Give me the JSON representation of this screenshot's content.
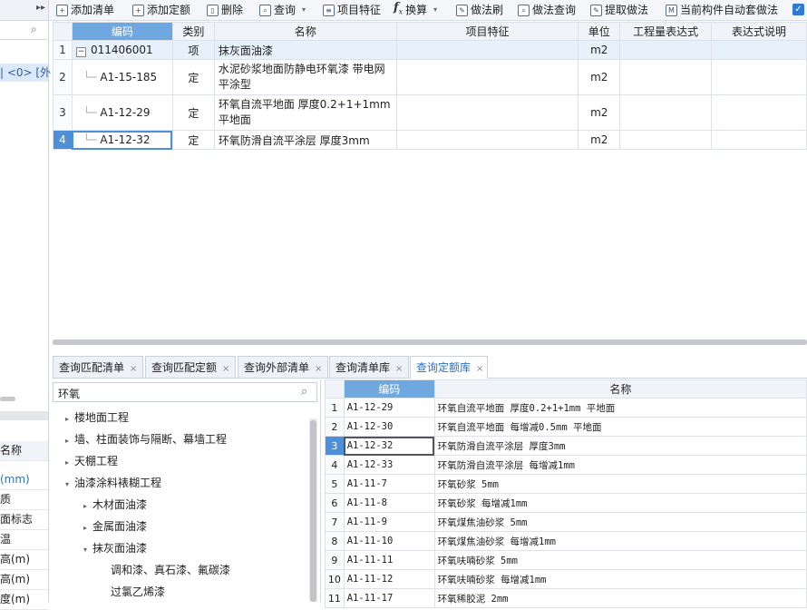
{
  "left_panel": {
    "selected_row": "| <0> [外",
    "list_header": "名称",
    "list_items": [
      "(mm)",
      "质",
      "面标志",
      "温",
      "高(m)",
      "高(m)",
      "度(m)"
    ]
  },
  "toolbar": {
    "items": [
      {
        "label": "添加清单",
        "icon": "add-list-icon"
      },
      {
        "label": "添加定额",
        "icon": "add-quota-icon"
      },
      {
        "label": "删除",
        "icon": "delete-icon"
      },
      {
        "label": "查询",
        "icon": "query-icon"
      },
      {
        "label": "项目特征",
        "icon": "feature-icon"
      },
      {
        "label": "换算",
        "icon": "fx-icon"
      },
      {
        "label": "做法刷",
        "icon": "brush-icon"
      },
      {
        "label": "做法查询",
        "icon": "method-query-icon"
      },
      {
        "label": "提取做法",
        "icon": "extract-icon"
      },
      {
        "label": "当前构件自动套做法",
        "icon": "auto-apply-icon"
      }
    ]
  },
  "main_table": {
    "columns": [
      "编码",
      "类别",
      "名称",
      "项目特征",
      "单位",
      "工程量表达式",
      "表达式说明"
    ],
    "rows": [
      {
        "num": "1",
        "code": "011406001",
        "type": "项",
        "name": "抹灰面油漆",
        "feature": "",
        "unit": "m2",
        "expr": "",
        "desc": ""
      },
      {
        "num": "2",
        "code": "A1-15-185",
        "type": "定",
        "name": "水泥砂浆地面防静电环氧漆 带电网平涂型",
        "feature": "",
        "unit": "m2",
        "expr": "",
        "desc": ""
      },
      {
        "num": "3",
        "code": "A1-12-29",
        "type": "定",
        "name": "环氧自流平地面 厚度0.2+1+1mm 平地面",
        "feature": "",
        "unit": "m2",
        "expr": "",
        "desc": ""
      },
      {
        "num": "4",
        "code": "A1-12-32",
        "type": "定",
        "name": "环氧防滑自流平涂层 厚度3mm",
        "feature": "",
        "unit": "m2",
        "expr": "",
        "desc": ""
      }
    ]
  },
  "bottom_tabs": [
    {
      "label": "查询匹配清单",
      "close": "×"
    },
    {
      "label": "查询匹配定额",
      "close": "×"
    },
    {
      "label": "查询外部清单",
      "close": "×"
    },
    {
      "label": "查询清单库",
      "close": "×"
    },
    {
      "label": "查询定额库",
      "close": "×"
    }
  ],
  "tree": {
    "search_value": "环氧",
    "nodes": [
      {
        "label": "楼地面工程",
        "expander": "▸"
      },
      {
        "label": "墙、柱面装饰与隔断、幕墙工程",
        "expander": "▸"
      },
      {
        "label": "天棚工程",
        "expander": "▸"
      },
      {
        "label": "油漆涂料裱糊工程",
        "expander": "▾"
      },
      {
        "label": "木材面油漆",
        "expander": "▸"
      },
      {
        "label": "金属面油漆",
        "expander": "▸"
      },
      {
        "label": "抹灰面油漆",
        "expander": "▾"
      },
      {
        "label": "调和漆、真石漆、氟碳漆",
        "expander": ""
      },
      {
        "label": "过氯乙烯漆",
        "expander": ""
      }
    ]
  },
  "quota_table": {
    "columns": [
      "编码",
      "名称"
    ],
    "rows": [
      {
        "num": "1",
        "code": "A1-12-29",
        "name": "环氧自流平地面 厚度0.2+1+1mm 平地面"
      },
      {
        "num": "2",
        "code": "A1-12-30",
        "name": "环氧自流平地面 每增减0.5mm 平地面"
      },
      {
        "num": "3",
        "code": "A1-12-32",
        "name": "环氧防滑自流平涂层 厚度3mm"
      },
      {
        "num": "4",
        "code": "A1-12-33",
        "name": "环氧防滑自流平涂层 每增减1mm"
      },
      {
        "num": "5",
        "code": "A1-11-7",
        "name": "环氧砂浆 5mm"
      },
      {
        "num": "6",
        "code": "A1-11-8",
        "name": "环氧砂浆 每增减1mm"
      },
      {
        "num": "7",
        "code": "A1-11-9",
        "name": "环氧煤焦油砂浆 5mm"
      },
      {
        "num": "8",
        "code": "A1-11-10",
        "name": "环氧煤焦油砂浆 每增减1mm"
      },
      {
        "num": "9",
        "code": "A1-11-11",
        "name": "环氧呋喃砂浆 5mm"
      },
      {
        "num": "10",
        "code": "A1-11-12",
        "name": "环氧呋喃砂浆 每增减1mm"
      },
      {
        "num": "11",
        "code": "A1-11-17",
        "name": "环氧稀胶泥 2mm"
      }
    ]
  },
  "colors": {
    "accent": "#4f8fd8",
    "header_highlight": "#6fa8e0",
    "active_tab_text": "#2a6fc4"
  }
}
